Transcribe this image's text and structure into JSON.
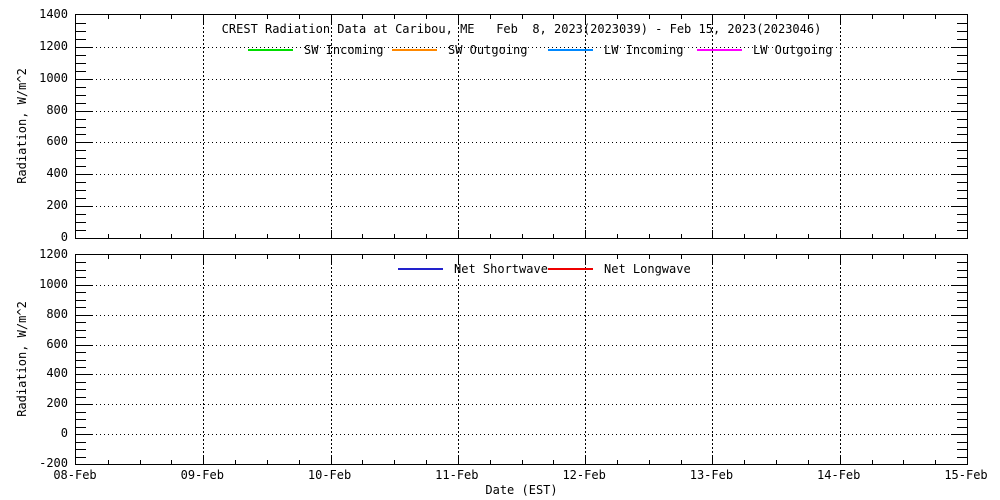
{
  "figure": {
    "title": "CREST Radiation Data at Caribou, ME   Feb  8, 2023(2023039) - Feb 15, 2023(2023046)",
    "xlabel": "Date (EST)",
    "background": "#ffffff",
    "frame_color": "#000000"
  },
  "chart_data": [
    {
      "type": "line",
      "panel": "top",
      "ylabel": "Radiation, W/m^2",
      "ylim": [
        0,
        1400
      ],
      "yticks": [
        0,
        200,
        400,
        600,
        800,
        1000,
        1200,
        1400
      ],
      "y_minor_step": 50,
      "x_tick_labels": [
        "08-Feb",
        "09-Feb",
        "10-Feb",
        "11-Feb",
        "12-Feb",
        "13-Feb",
        "14-Feb",
        "15-Feb"
      ],
      "x_minor_divisions": 4,
      "grid": {
        "horizontal": "dotted",
        "vertical": "dotted",
        "at": "major-ticks"
      },
      "legend_position": "top-inside",
      "series": [
        {
          "name": "SW Incoming",
          "color": "#00dd00",
          "values": []
        },
        {
          "name": "SW Outgoing",
          "color": "#ff8800",
          "values": []
        },
        {
          "name": "LW Incoming",
          "color": "#0088ff",
          "values": []
        },
        {
          "name": "LW Outgoing",
          "color": "#ff00ff",
          "values": []
        }
      ]
    },
    {
      "type": "line",
      "panel": "bottom",
      "ylabel": "Radiation, W/m^2",
      "ylim": [
        -200,
        1200
      ],
      "yticks": [
        -200,
        0,
        200,
        400,
        600,
        800,
        1000,
        1200
      ],
      "y_minor_step": 50,
      "x_tick_labels": [
        "08-Feb",
        "09-Feb",
        "10-Feb",
        "11-Feb",
        "12-Feb",
        "13-Feb",
        "14-Feb",
        "15-Feb"
      ],
      "x_minor_divisions": 4,
      "grid": {
        "horizontal": "dotted",
        "vertical": "dotted",
        "at": "major-ticks"
      },
      "legend_position": "top-inside",
      "series": [
        {
          "name": "Net Shortwave",
          "color": "#2222cc",
          "values": []
        },
        {
          "name": "Net Longwave",
          "color": "#ee0000",
          "values": []
        }
      ]
    }
  ]
}
